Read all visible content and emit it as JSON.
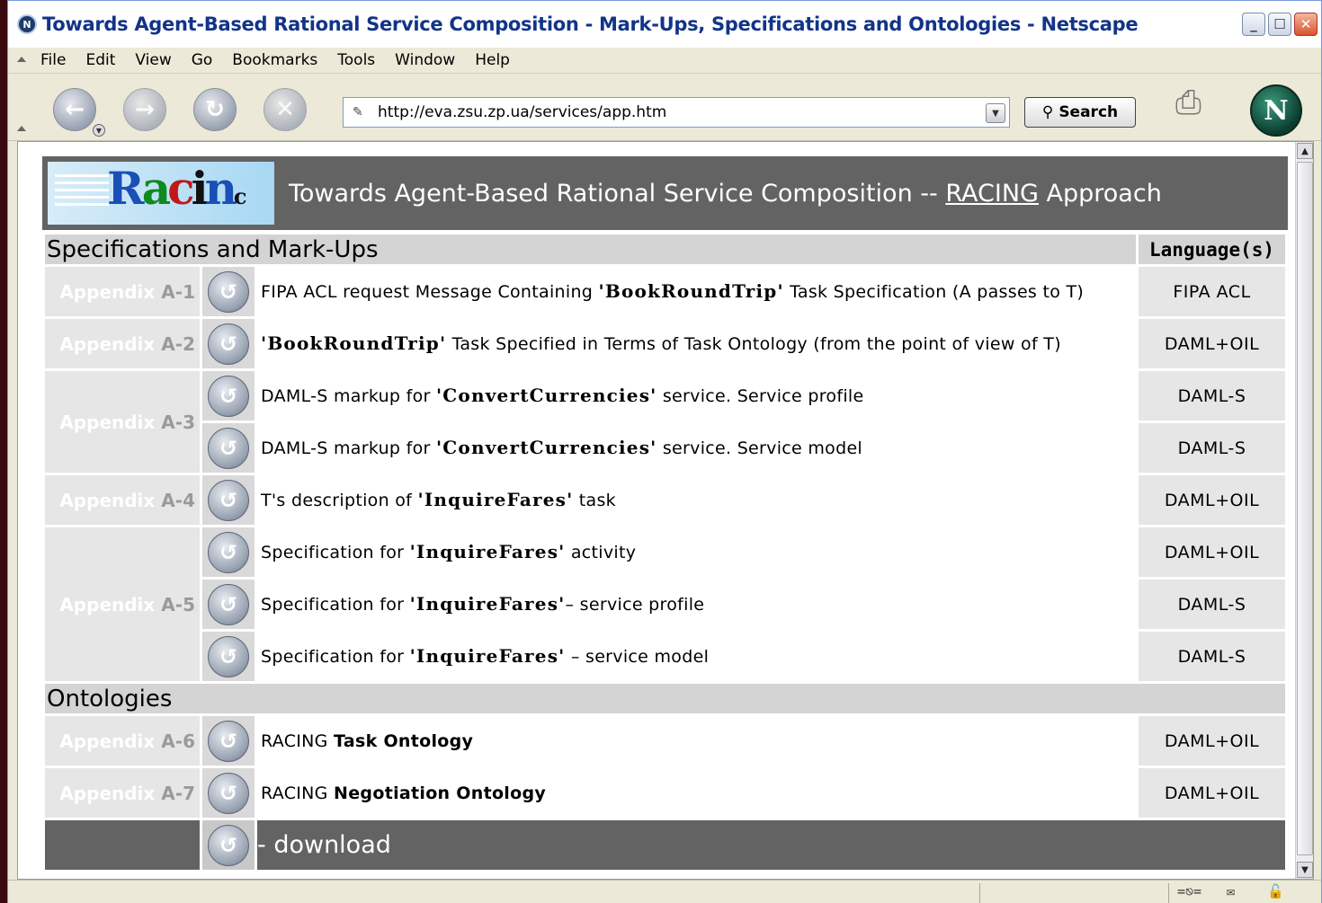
{
  "window": {
    "title": "Towards Agent-Based Rational Service Composition - Mark-Ups, Specifications and Ontologies - Netscape",
    "minimize": "_",
    "maximize": "☐",
    "close": "✕"
  },
  "menu": [
    "File",
    "Edit",
    "View",
    "Go",
    "Bookmarks",
    "Tools",
    "Window",
    "Help"
  ],
  "toolbar": {
    "url": "http://eva.zsu.zp.ua/services/app.htm",
    "search_label": "Search"
  },
  "header": {
    "title_prefix": "Towards Agent-Based Rational Service Composition -- ",
    "title_link": "RACING",
    "title_suffix": " Approach"
  },
  "sections": {
    "spec": "Specifications and Mark-Ups",
    "lang_header": "Language(s)",
    "ontologies": "Ontologies"
  },
  "appendix_word": "Appendix",
  "rows": [
    {
      "appendix": "A-1",
      "pre": "FIPA ACL request Message Containing ",
      "mono": "'BookRoundTrip'",
      "post": " Task Specification (A passes to T)",
      "lang": "FIPA ACL"
    },
    {
      "appendix": "A-2",
      "pre": "",
      "mono": "'BookRoundTrip'",
      "post": " Task Specified in Terms of Task Ontology (from the point of view of T)",
      "lang": "DAML+OIL"
    },
    {
      "appendix": "A-3",
      "pre": "DAML-S markup for ",
      "mono": "'ConvertCurrencies'",
      "post": "  service. Service profile",
      "lang": "DAML-S"
    },
    {
      "appendix": "",
      "pre": "DAML-S markup for ",
      "mono": "'ConvertCurrencies'",
      "post": "  service. Service model",
      "lang": "DAML-S"
    },
    {
      "appendix": "A-4",
      "pre": "T's description of ",
      "mono": "'InquireFares'",
      "post": "  task",
      "lang": "DAML+OIL"
    },
    {
      "appendix": "A-5",
      "pre": "Specification for ",
      "mono": "'InquireFares'",
      "post": " activity",
      "lang": "DAML+OIL"
    },
    {
      "appendix": "",
      "pre": "Specification for ",
      "mono": "'InquireFares'",
      "post": "– service profile",
      "lang": "DAML-S"
    },
    {
      "appendix": "",
      "pre": "Specification for ",
      "mono": "'InquireFares'",
      "post": " – service model",
      "lang": "DAML-S"
    }
  ],
  "ontology_rows": [
    {
      "appendix": "A-6",
      "pre": "RACING ",
      "bold": "Task Ontology",
      "lang": "DAML+OIL"
    },
    {
      "appendix": "A-7",
      "pre": "RACING ",
      "bold": "Negotiation Ontology",
      "lang": "DAML+OIL"
    }
  ],
  "download": "- download",
  "colors": {
    "header_bg": "#636363",
    "section_bg": "#d4d4d4",
    "cell_bg": "#e6e6e6",
    "title_text": "#123488"
  }
}
